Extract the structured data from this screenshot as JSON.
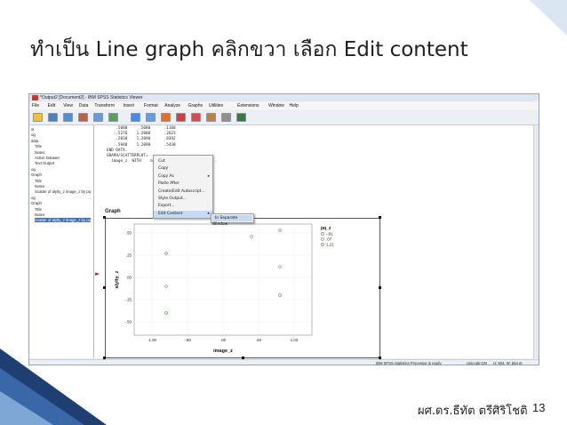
{
  "slide": {
    "title": "ทำเป็น Line graph คลิกขวา เลือก Edit content",
    "author": "ผศ.ดร.ธีทัต ตรีศิริโชติ",
    "page_number": "13",
    "accent_color": "#1f3f73"
  },
  "window": {
    "title": "*Output2 [Document2] - IBM SPSS Statistics Viewer",
    "menu": [
      "File",
      "Edit",
      "View",
      "Data",
      "Transform",
      "Insert",
      "Format",
      "Analyze",
      "Graphs",
      "Utilities",
      "Extensions",
      "Window",
      "Help"
    ]
  },
  "outline": {
    "items": [
      {
        "label": "st"
      },
      {
        "label": "og"
      },
      {
        "label": "data"
      },
      {
        "label": "Title"
      },
      {
        "label": "Notes"
      },
      {
        "label": "Active Dataset"
      },
      {
        "label": "Text Output"
      },
      {
        "label": "og"
      },
      {
        "label": "Graph"
      },
      {
        "label": "Title"
      },
      {
        "label": "Notes"
      },
      {
        "label": "Scatter of alylty_z image_z by pq"
      },
      {
        "label": "og"
      },
      {
        "label": "Graph"
      },
      {
        "label": "Title"
      },
      {
        "label": "Notes"
      },
      {
        "label": "Scatter of alylty_z image_z by pq"
      }
    ]
  },
  "syntax": {
    "lines": [
      "    .5080     .5080      .1100",
      "   -.5276    1.2080      .2623",
      "    .2010    1.2090      .8392",
      "    .5940    1.2090      .5430",
      "END DATA.",
      "GRAPH/SCATTERPLOT=",
      "  image_z  WITH    alylty_z BY        pq_z     ."
    ]
  },
  "output": {
    "graph_heading": "Graph"
  },
  "chart_data": {
    "type": "scatter",
    "xlabel": "image_z",
    "ylabel": "alylty_z",
    "xlim": [
      -1.25,
      1.25
    ],
    "ylim": [
      -0.65,
      0.6
    ],
    "x_ticks": [
      "-1.00",
      "-.50",
      ".00",
      ".50",
      "1.00"
    ],
    "x_tick_values": [
      -1.0,
      -0.5,
      0.0,
      0.5,
      1.0
    ],
    "y_ticks": [
      ".50",
      ".25",
      ".00",
      "-.25",
      "-.50"
    ],
    "y_tick_values": [
      0.5,
      0.25,
      0.0,
      -0.25,
      -0.5
    ],
    "legend_title": "pq_z",
    "legend_position": "top-right",
    "series": [
      {
        "name": "-.91",
        "color": "#4aa84a",
        "points": [
          [
            -0.8,
            0.27
          ],
          [
            -0.8,
            -0.4
          ]
        ]
      },
      {
        "name": ".07",
        "color": "#d97a7a",
        "points": [
          [
            0.4,
            0.46
          ],
          [
            0.8,
            0.12
          ],
          [
            -0.8,
            -0.1
          ]
        ]
      },
      {
        "name": "1.21",
        "color": "#4aa84a",
        "points": [
          [
            0.8,
            0.53
          ],
          [
            0.8,
            -0.2
          ]
        ]
      }
    ]
  },
  "context_menu": {
    "items": [
      {
        "label": "Cut",
        "submenu": false
      },
      {
        "label": "Copy",
        "submenu": false
      },
      {
        "label": "Copy As",
        "submenu": true
      },
      {
        "label": "Paste After",
        "submenu": false
      },
      {
        "label": "Create/Edit Autoscript...",
        "submenu": false
      },
      {
        "label": "Style Output...",
        "submenu": false
      },
      {
        "label": "Export...",
        "submenu": false
      },
      {
        "label": "Edit Content",
        "submenu": true
      }
    ],
    "highlighted_index": 7,
    "submenu_item": "In Separate Window"
  },
  "status": {
    "processor": "IBM SPSS Statistics Processor is ready",
    "encoding": "Unicode:ON",
    "dimensions": "H: 504, W: 654 pt"
  }
}
